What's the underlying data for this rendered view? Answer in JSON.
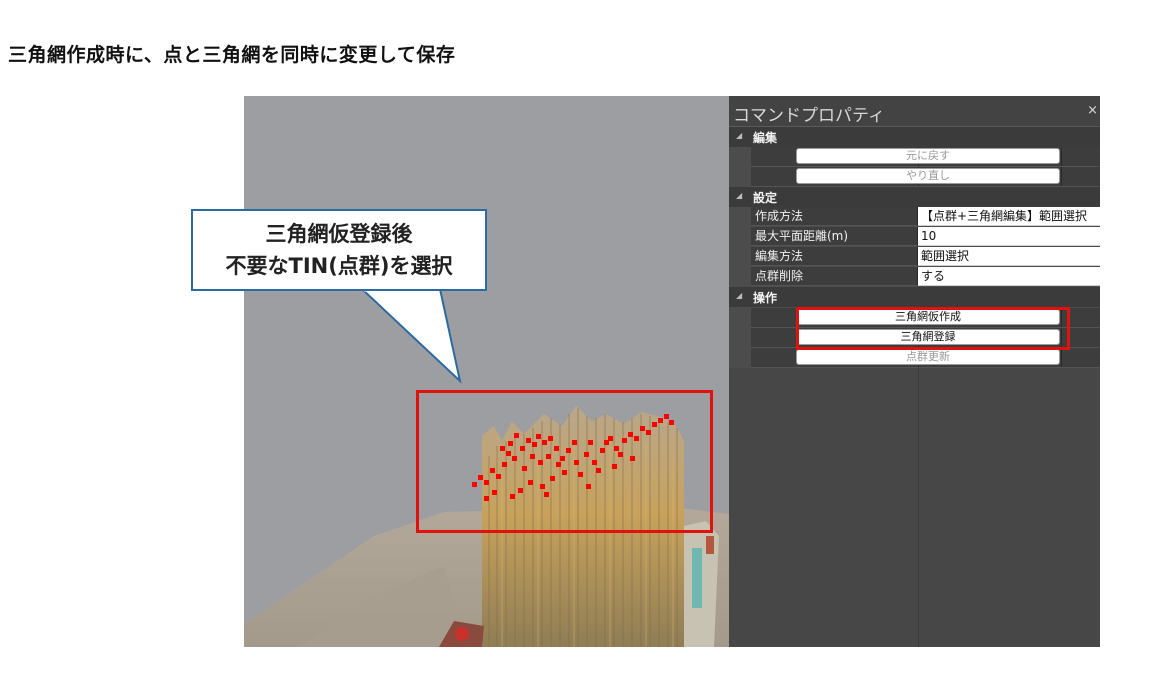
{
  "heading": "三角網作成時に、点と三角網を同時に変更して保存",
  "callout": {
    "line1": "三角網仮登録後",
    "line2": "不要なTIN(点群)を選択"
  },
  "panel": {
    "title": "コマンドプロパティ",
    "close": "×",
    "sections": {
      "edit": {
        "label": "編集",
        "buttons": {
          "undo": "元に戻す",
          "redo": "やり直し"
        }
      },
      "settings": {
        "label": "設定",
        "props": [
          {
            "label": "作成方法",
            "value": "【点群+三角網編集】範囲選択"
          },
          {
            "label": "最大平面距離(m)",
            "value": "10"
          },
          {
            "label": "編集方法",
            "value": "範囲選択"
          },
          {
            "label": "点群削除",
            "value": "する"
          }
        ]
      },
      "operation": {
        "label": "操作",
        "buttons": {
          "temp_create": "三角網仮作成",
          "register": "三角網登録",
          "update_points": "点群更新"
        }
      }
    }
  },
  "colors": {
    "highlight": "#e0120e",
    "callout_border": "#2d6aa0",
    "viewport_bg": "#9d9ea2",
    "panel_bg": "#4c4c4c"
  }
}
